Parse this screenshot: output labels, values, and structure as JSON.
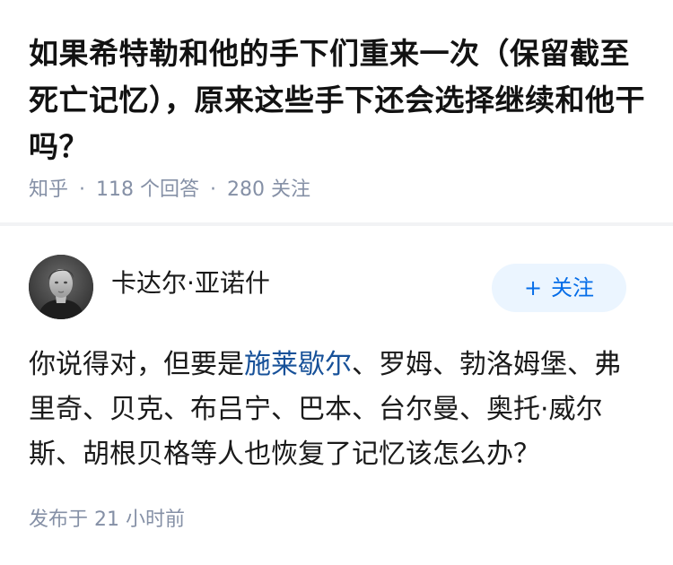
{
  "question": {
    "title": "如果希特勒和他的手下们重来一次（保留截至死亡记忆），原来这些手下还会选择继续和他干吗？",
    "source": "知乎",
    "separator": "·",
    "answer_count": "118 个回答",
    "follower_count": "280 关注"
  },
  "answer": {
    "author_name": "卡达尔·亚诺什",
    "follow_plus": "+",
    "follow_label": "关注",
    "body_before_link": "你说得对，但要是",
    "body_link": "施莱歇尔",
    "body_after_link": "、罗姆、勃洛姆堡、弗里奇、贝克、布吕宁、巴本、台尔曼、奥托·威尔斯、胡根贝格等人也恢复了记忆该怎么办？",
    "published": "发布于 21 小时前"
  },
  "colors": {
    "meta_gray": "#8590a6",
    "link_blue": "#175199",
    "follow_blue": "#056de8",
    "follow_bg": "#ebf5ff",
    "divider": "#f2f3f5"
  },
  "icons": {
    "avatar": "author-avatar-portrait"
  }
}
